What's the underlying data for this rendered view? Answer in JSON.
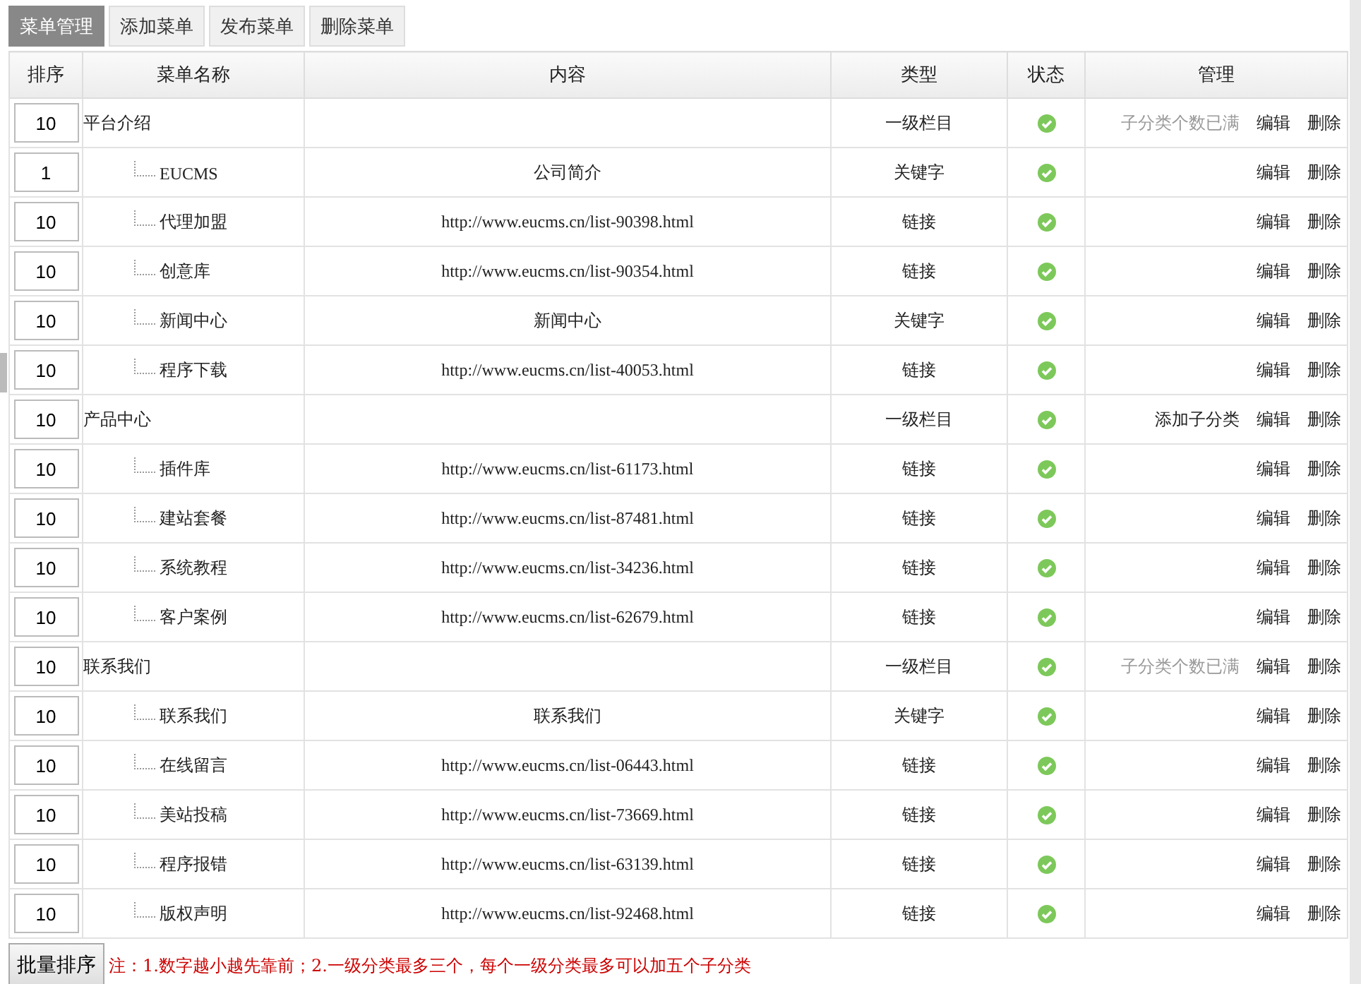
{
  "tabs": [
    {
      "label": "菜单管理",
      "selected": true
    },
    {
      "label": "添加菜单",
      "selected": false
    },
    {
      "label": "发布菜单",
      "selected": false
    },
    {
      "label": "删除菜单",
      "selected": false
    }
  ],
  "columns": [
    "排序",
    "菜单名称",
    "内容",
    "类型",
    "状态",
    "管理"
  ],
  "menus": [
    {
      "order": "10",
      "name": "平台介绍",
      "type": "一级栏目",
      "enabled": true,
      "note": "子分类个数已满",
      "note_disabled": true,
      "edit": "编辑",
      "delete": "删除",
      "children": [
        {
          "order": "1",
          "name": "EUCMS",
          "kind": "keyword",
          "content": "公司简介",
          "type": "关键字",
          "enabled": true,
          "edit": "编辑",
          "delete": "删除"
        },
        {
          "order": "10",
          "name": "代理加盟",
          "kind": "link",
          "content": "http://www.eucms.cn/list-90398.html",
          "type": "链接",
          "enabled": true,
          "edit": "编辑",
          "delete": "删除"
        },
        {
          "order": "10",
          "name": "创意库",
          "kind": "link",
          "content": "http://www.eucms.cn/list-90354.html",
          "type": "链接",
          "enabled": true,
          "edit": "编辑",
          "delete": "删除"
        },
        {
          "order": "10",
          "name": "新闻中心",
          "kind": "keyword",
          "content": "新闻中心",
          "type": "关键字",
          "enabled": true,
          "edit": "编辑",
          "delete": "删除"
        },
        {
          "order": "10",
          "name": "程序下载",
          "kind": "link",
          "content": "http://www.eucms.cn/list-40053.html",
          "type": "链接",
          "enabled": true,
          "edit": "编辑",
          "delete": "删除"
        }
      ]
    },
    {
      "order": "10",
      "name": "产品中心",
      "type": "一级栏目",
      "enabled": true,
      "note": "添加子分类",
      "note_disabled": false,
      "edit": "编辑",
      "delete": "删除",
      "children": [
        {
          "order": "10",
          "name": "插件库",
          "kind": "link",
          "content": "http://www.eucms.cn/list-61173.html",
          "type": "链接",
          "enabled": true,
          "edit": "编辑",
          "delete": "删除"
        },
        {
          "order": "10",
          "name": "建站套餐",
          "kind": "link",
          "content": "http://www.eucms.cn/list-87481.html",
          "type": "链接",
          "enabled": true,
          "edit": "编辑",
          "delete": "删除"
        },
        {
          "order": "10",
          "name": "系统教程",
          "kind": "link",
          "content": "http://www.eucms.cn/list-34236.html",
          "type": "链接",
          "enabled": true,
          "edit": "编辑",
          "delete": "删除"
        },
        {
          "order": "10",
          "name": "客户案例",
          "kind": "link",
          "content": "http://www.eucms.cn/list-62679.html",
          "type": "链接",
          "enabled": true,
          "edit": "编辑",
          "delete": "删除"
        }
      ]
    },
    {
      "order": "10",
      "name": "联系我们",
      "type": "一级栏目",
      "enabled": true,
      "note": "子分类个数已满",
      "note_disabled": true,
      "edit": "编辑",
      "delete": "删除",
      "children": [
        {
          "order": "10",
          "name": "联系我们",
          "kind": "keyword",
          "content": "联系我们",
          "type": "关键字",
          "enabled": true,
          "edit": "编辑",
          "delete": "删除"
        },
        {
          "order": "10",
          "name": "在线留言",
          "kind": "link",
          "content": "http://www.eucms.cn/list-06443.html",
          "type": "链接",
          "enabled": true,
          "edit": "编辑",
          "delete": "删除"
        },
        {
          "order": "10",
          "name": "美站投稿",
          "kind": "link",
          "content": "http://www.eucms.cn/list-73669.html",
          "type": "链接",
          "enabled": true,
          "edit": "编辑",
          "delete": "删除"
        },
        {
          "order": "10",
          "name": "程序报错",
          "kind": "link",
          "content": "http://www.eucms.cn/list-63139.html",
          "type": "链接",
          "enabled": true,
          "edit": "编辑",
          "delete": "删除"
        },
        {
          "order": "10",
          "name": "版权声明",
          "kind": "link",
          "content": "http://www.eucms.cn/list-92468.html",
          "type": "链接",
          "enabled": true,
          "edit": "编辑",
          "delete": "删除"
        }
      ]
    }
  ],
  "footer": {
    "button": "批量排序",
    "note": "注：1.数字越小越先靠前；2.一级分类最多三个，每个一级分类最多可以加五个子分类"
  }
}
